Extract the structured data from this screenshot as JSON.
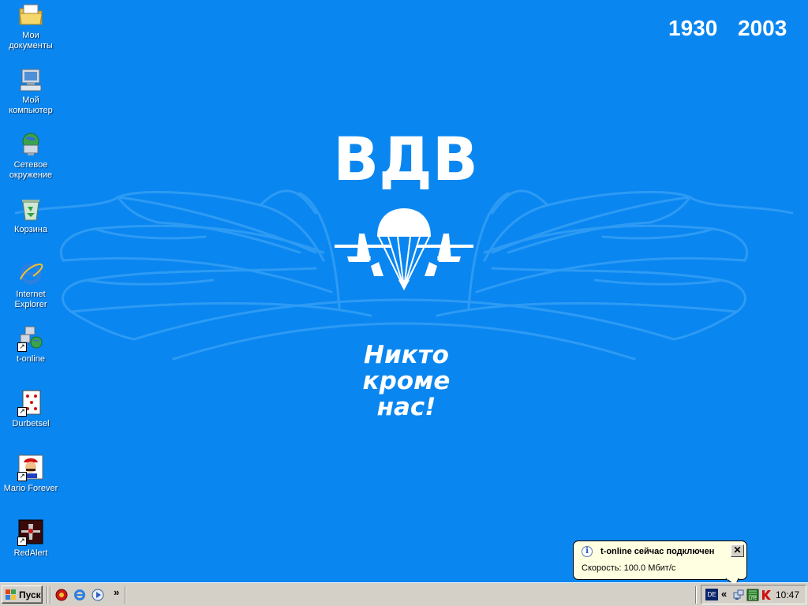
{
  "wallpaper": {
    "year_start": "1930",
    "year_end": "2003",
    "title": "ВДВ",
    "motto_line1": "Никто",
    "motto_line2": "кроме",
    "motto_line3": "нас!",
    "colors": {
      "background": "#0a86f0",
      "wings": "#2d9bf4",
      "text": "#ffffff"
    }
  },
  "desktop_icons": [
    {
      "label": "Мои\nдокументы",
      "icon": "my-documents-folder-icon"
    },
    {
      "label": "Мой\nкомпьютер",
      "icon": "my-computer-icon"
    },
    {
      "label": "Сетевое\nокружение",
      "icon": "network-places-icon"
    },
    {
      "label": "Корзина",
      "icon": "recycle-bin-icon"
    },
    {
      "label": "Internet\nExplorer",
      "icon": "internet-explorer-icon"
    },
    {
      "label": "t-online",
      "icon": "t-online-icon"
    },
    {
      "label": "Durbetsel",
      "icon": "dice-card-icon"
    },
    {
      "label": "Mario Forever",
      "icon": "mario-icon"
    },
    {
      "label": "RedAlert",
      "icon": "red-alert-icon"
    }
  ],
  "taskbar": {
    "start_label": "Пуск",
    "quicklaunch_more": "»",
    "tray_expand": "«",
    "language": "DE",
    "clock": "10:47"
  },
  "balloon": {
    "title": "t-online сейчас подключен",
    "text": "Скорость: 100.0 Мбит/с",
    "close": "✕"
  }
}
